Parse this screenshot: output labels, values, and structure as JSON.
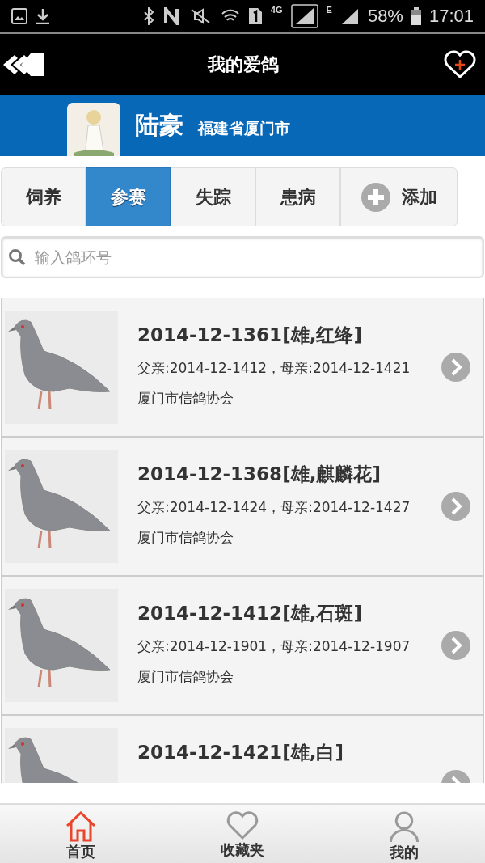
{
  "status_bar": {
    "network": "4G",
    "network2": "E",
    "battery": "58%",
    "time": "17:01"
  },
  "header": {
    "title": "我的爱鸽"
  },
  "profile": {
    "name": "陆豪",
    "location": "福建省厦门市"
  },
  "tabs": [
    {
      "label": "饲养",
      "selected": false
    },
    {
      "label": "参赛",
      "selected": true
    },
    {
      "label": "失踪",
      "selected": false
    },
    {
      "label": "患病",
      "selected": false
    },
    {
      "label": "添加",
      "selected": false,
      "kind": "add"
    }
  ],
  "search": {
    "placeholder": "输入鸽环号"
  },
  "pigeons": [
    {
      "title": "2014-12-1361[雄,红绛]",
      "parents": "父亲:2014-12-1412，母亲:2014-12-1421",
      "association": "厦门市信鸽协会"
    },
    {
      "title": "2014-12-1368[雄,麒麟花]",
      "parents": "父亲:2014-12-1424，母亲:2014-12-1427",
      "association": "厦门市信鸽协会"
    },
    {
      "title": "2014-12-1412[雄,石斑]",
      "parents": "父亲:2014-12-1901，母亲:2014-12-1907",
      "association": "厦门市信鸽协会"
    },
    {
      "title": "2014-12-1421[雄,白]"
    }
  ],
  "nav": [
    {
      "label": "首页",
      "selected": true,
      "kind": "home"
    },
    {
      "label": "收藏夹",
      "selected": false,
      "kind": "heart"
    },
    {
      "label": "我的",
      "selected": false,
      "kind": "person"
    }
  ]
}
